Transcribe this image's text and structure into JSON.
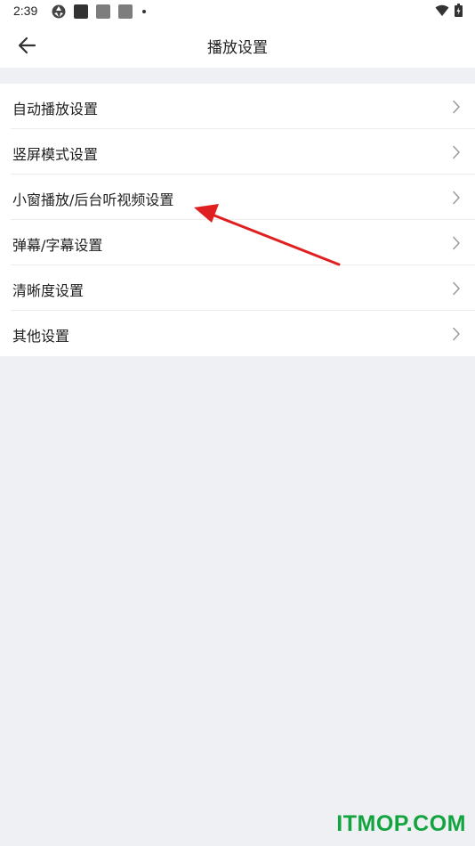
{
  "status_bar": {
    "time": "2:39"
  },
  "header": {
    "title": "播放设置"
  },
  "settings": {
    "items": [
      {
        "label": "自动播放设置"
      },
      {
        "label": "竖屏模式设置"
      },
      {
        "label": "小窗播放/后台听视频设置"
      },
      {
        "label": "弹幕/字幕设置"
      },
      {
        "label": "清晰度设置"
      },
      {
        "label": "其他设置"
      }
    ]
  },
  "watermark": {
    "text": "ITMOP.COM"
  },
  "colors": {
    "background": "#eef0f3",
    "annotation_arrow": "#e02020",
    "watermark": "#14a43f"
  },
  "icons": {
    "back": "arrow-left-icon",
    "row": "chevron-right-icon"
  }
}
